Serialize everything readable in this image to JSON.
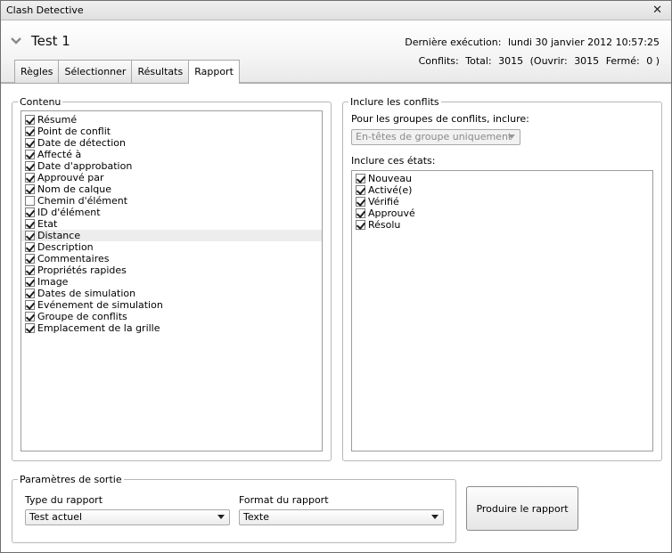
{
  "window": {
    "title": "Clash Detective",
    "close_symbol": "✕"
  },
  "header": {
    "test_name": "Test 1",
    "last_run_label": "Dernière exécution:",
    "last_run_value": "lundi 30 janvier 2012 10:57:25",
    "conflicts_label": "Conflits:",
    "total_label": "Total:",
    "total_value": "3015",
    "open_label": "(Ouvrir:",
    "open_value": "3015",
    "closed_label": "Fermé:",
    "closed_value": "0 )"
  },
  "tabs": [
    {
      "label": "Règles",
      "active": false
    },
    {
      "label": "Sélectionner",
      "active": false
    },
    {
      "label": "Résultats",
      "active": false
    },
    {
      "label": "Rapport",
      "active": true
    }
  ],
  "content_group": {
    "legend": "Contenu",
    "items": [
      {
        "label": "Résumé",
        "checked": true
      },
      {
        "label": "Point de conflit",
        "checked": true
      },
      {
        "label": "Date de détection",
        "checked": true
      },
      {
        "label": "Affecté à",
        "checked": true
      },
      {
        "label": "Date d'approbation",
        "checked": true
      },
      {
        "label": "Approuvé par",
        "checked": true
      },
      {
        "label": "Nom de calque",
        "checked": true
      },
      {
        "label": "Chemin d'élément",
        "checked": false
      },
      {
        "label": "ID d'élément",
        "checked": true
      },
      {
        "label": "Etat",
        "checked": true
      },
      {
        "label": "Distance",
        "checked": true
      },
      {
        "label": "Description",
        "checked": true
      },
      {
        "label": "Commentaires",
        "checked": true
      },
      {
        "label": "Propriétés rapides",
        "checked": true
      },
      {
        "label": "Image",
        "checked": true
      },
      {
        "label": "Dates de simulation",
        "checked": true
      },
      {
        "label": "Evénement de simulation",
        "checked": true
      },
      {
        "label": "Groupe de conflits",
        "checked": true
      },
      {
        "label": "Emplacement de la grille",
        "checked": true
      }
    ]
  },
  "include_group": {
    "legend": "Inclure les conflits",
    "groups_label": "Pour les groupes de conflits, inclure:",
    "groups_value": "En-têtes de groupe uniquement",
    "states_label": "Inclure ces états:",
    "states": [
      {
        "label": "Nouveau",
        "checked": true
      },
      {
        "label": "Activé(e)",
        "checked": true
      },
      {
        "label": "Vérifié",
        "checked": true
      },
      {
        "label": "Approuvé",
        "checked": true
      },
      {
        "label": "Résolu",
        "checked": true
      }
    ]
  },
  "output_group": {
    "legend": "Paramètres de sortie",
    "report_type_label": "Type du rapport",
    "report_type_value": "Test actuel",
    "report_format_label": "Format du rapport",
    "report_format_value": "Texte"
  },
  "produce_button_label": "Produire le rapport"
}
